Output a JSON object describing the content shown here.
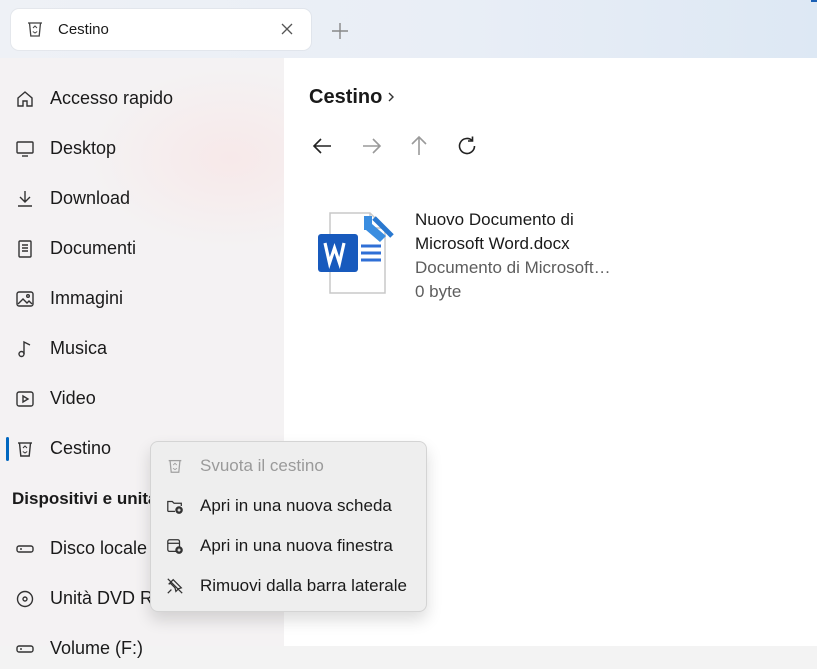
{
  "tab": {
    "title": "Cestino",
    "icon": "recycle-bin-icon"
  },
  "sidebar": {
    "items": [
      {
        "label": "Accesso rapido",
        "icon": "home-icon"
      },
      {
        "label": "Desktop",
        "icon": "monitor-icon"
      },
      {
        "label": "Download",
        "icon": "download-icon"
      },
      {
        "label": "Documenti",
        "icon": "document-icon"
      },
      {
        "label": "Immagini",
        "icon": "image-icon"
      },
      {
        "label": "Musica",
        "icon": "music-icon"
      },
      {
        "label": "Video",
        "icon": "video-icon"
      },
      {
        "label": "Cestino",
        "icon": "recycle-bin-icon",
        "selected": true
      }
    ],
    "section_header": "Dispositivi e unità",
    "devices": [
      {
        "label": "Disco locale (",
        "icon": "drive-icon"
      },
      {
        "label": "Unità DVD RW",
        "icon": "dvd-icon"
      },
      {
        "label": "Volume (F:)",
        "icon": "drive-icon"
      }
    ]
  },
  "content": {
    "breadcrumb": "Cestino",
    "file": {
      "name": "Nuovo Documento di Microsoft Word.docx",
      "type": "Documento di Microsoft…",
      "size": "0 byte",
      "icon": "word-document-icon"
    }
  },
  "context_menu": {
    "items": [
      {
        "label": "Svuota il cestino",
        "icon": "recycle-bin-icon",
        "enabled": false
      },
      {
        "label": "Apri in una nuova scheda",
        "icon": "new-tab-icon",
        "enabled": true
      },
      {
        "label": "Apri in una nuova finestra",
        "icon": "new-window-icon",
        "enabled": true
      },
      {
        "label": "Rimuovi dalla barra laterale",
        "icon": "unpin-icon",
        "enabled": true
      }
    ]
  },
  "colors": {
    "accent": "#0067c0",
    "word_blue": "#185abd"
  }
}
